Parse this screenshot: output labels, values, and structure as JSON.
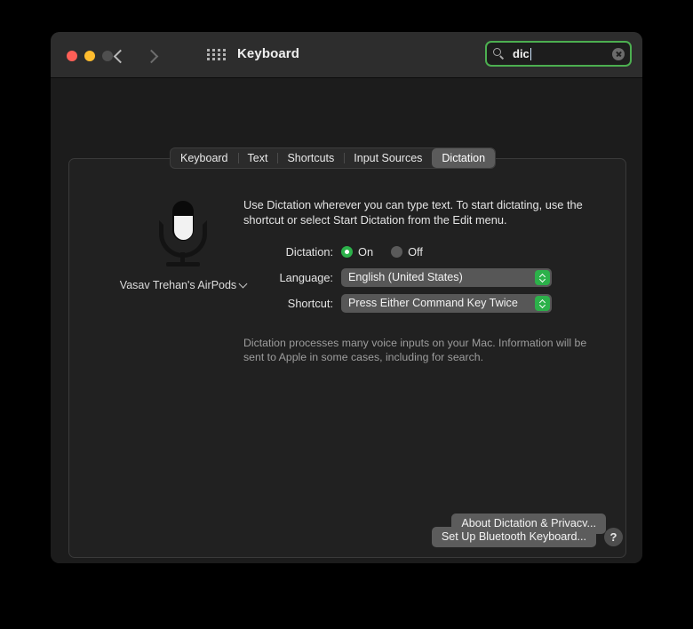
{
  "window": {
    "title": "Keyboard",
    "traffic_lights": [
      "close",
      "minimize",
      "zoom"
    ],
    "nav": {
      "back_icon": "chevron-left-icon",
      "forward_icon": "chevron-right-icon"
    },
    "grid_icon": "grid-apps-icon"
  },
  "search": {
    "value": "dic",
    "placeholder": "Search",
    "icon": "search-icon",
    "clear_icon": "clear-circle-icon",
    "focus_color": "#4caf50"
  },
  "tabs": [
    {
      "label": "Keyboard",
      "selected": false
    },
    {
      "label": "Text",
      "selected": false
    },
    {
      "label": "Shortcuts",
      "selected": false
    },
    {
      "label": "Input Sources",
      "selected": false
    },
    {
      "label": "Dictation",
      "selected": true
    }
  ],
  "mic": {
    "icon": "microphone-icon",
    "device_label": "Vasav Trehan's AirPods",
    "device_chevron_icon": "chevron-down-icon"
  },
  "main": {
    "intro": "Use Dictation wherever you can type text. To start dictating, use the shortcut or select Start Dictation from the Edit menu.",
    "dictation_label": "Dictation:",
    "dictation_on": "On",
    "dictation_off": "Off",
    "dictation_value": "On",
    "language_label": "Language:",
    "language_value": "English (United States)",
    "shortcut_label": "Shortcut:",
    "shortcut_value": "Press Either Command Key Twice",
    "note": "Dictation processes many voice inputs on your Mac. Information will be sent to Apple in some cases, including for search.",
    "about_button": "About Dictation & Privacy...",
    "accent_green": "#2cb14a"
  },
  "footer": {
    "setup_button": "Set Up Bluetooth Keyboard...",
    "help_button": "?"
  }
}
